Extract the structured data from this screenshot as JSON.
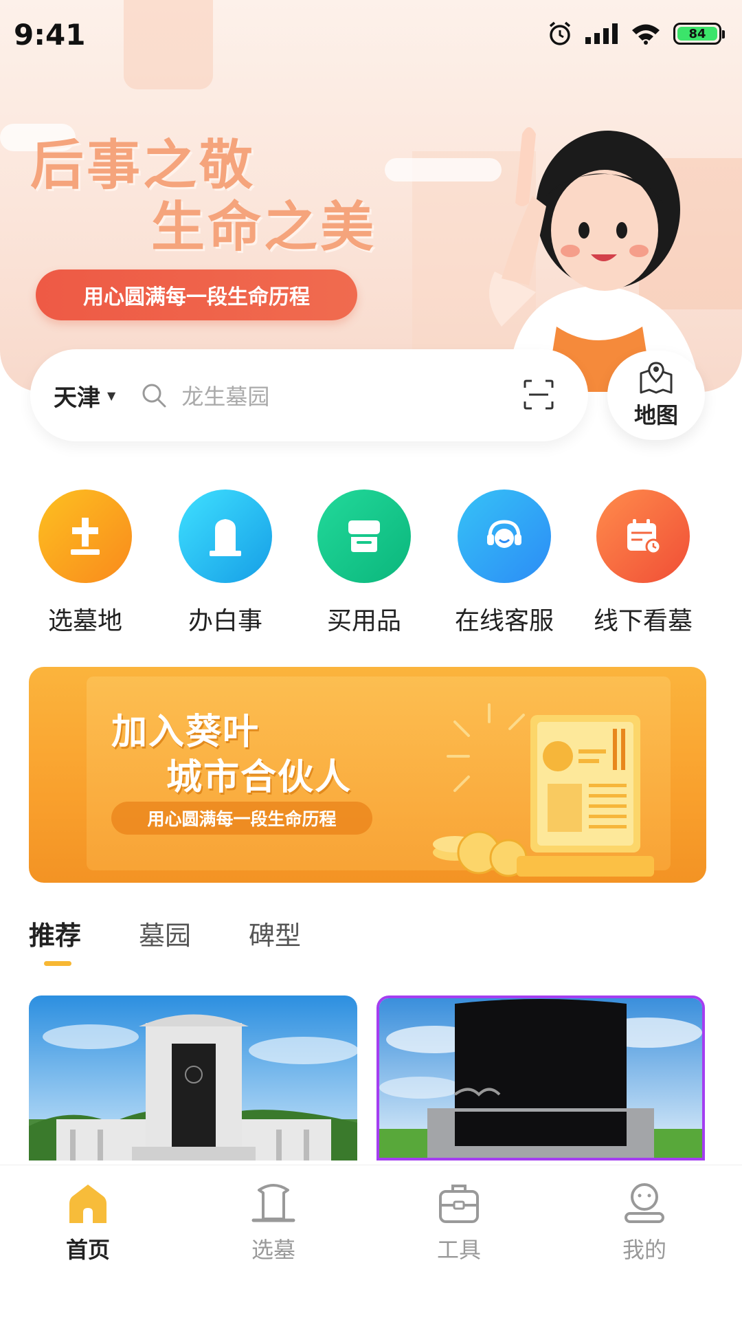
{
  "status_bar": {
    "time": "9:41",
    "battery": "84"
  },
  "hero": {
    "slogan_line1": "后事之敬",
    "slogan_line2": "生命之美",
    "pill_text": "用心圆满每一段生命历程"
  },
  "search": {
    "city": "天津",
    "placeholder": "龙生墓园",
    "map_label": "地图"
  },
  "categories": [
    {
      "label": "选墓地",
      "icon": "tombstone-cross-icon",
      "color": "#f9a21b"
    },
    {
      "label": "办白事",
      "icon": "headstone-icon",
      "color": "#2ec4f0"
    },
    {
      "label": "买用品",
      "icon": "store-icon",
      "color": "#16c88a"
    },
    {
      "label": "在线客服",
      "icon": "customer-service-icon",
      "color": "#3aa8f5"
    },
    {
      "label": "线下看墓",
      "icon": "calendar-icon",
      "color": "#f4673f"
    }
  ],
  "partner_banner": {
    "line1": "加入葵叶",
    "line2": "城市合伙人",
    "pill_text": "用心圆满每一段生命历程"
  },
  "tabs": [
    {
      "label": "推荐",
      "active": true
    },
    {
      "label": "墓园",
      "active": false
    },
    {
      "label": "碑型",
      "active": false
    }
  ],
  "bottom_nav": [
    {
      "label": "首页",
      "icon": "home-icon",
      "active": true
    },
    {
      "label": "选墓",
      "icon": "tomb-icon",
      "active": false
    },
    {
      "label": "工具",
      "icon": "toolbox-icon",
      "active": false
    },
    {
      "label": "我的",
      "icon": "profile-icon",
      "active": false
    }
  ]
}
